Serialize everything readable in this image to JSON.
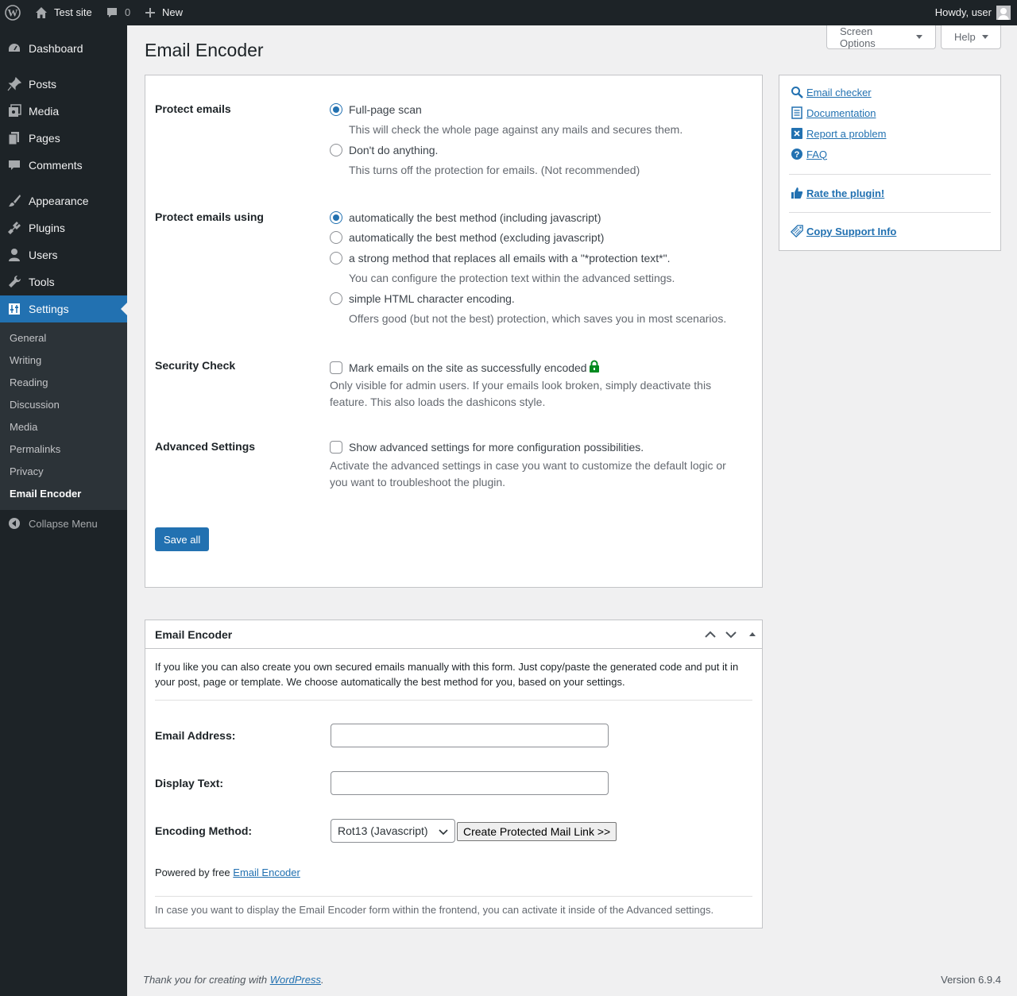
{
  "admin_bar": {
    "site_name": "Test site",
    "comments_count": "0",
    "new_label": "New",
    "howdy": "Howdy, user"
  },
  "sidebar": {
    "items": [
      {
        "label": "Dashboard",
        "icon": "dashboard-icon"
      },
      {
        "label": "Posts",
        "icon": "pin-icon"
      },
      {
        "label": "Media",
        "icon": "media-icon"
      },
      {
        "label": "Pages",
        "icon": "pages-icon"
      },
      {
        "label": "Comments",
        "icon": "comment-icon"
      },
      {
        "label": "Appearance",
        "icon": "brush-icon"
      },
      {
        "label": "Plugins",
        "icon": "plug-icon"
      },
      {
        "label": "Users",
        "icon": "user-icon"
      },
      {
        "label": "Tools",
        "icon": "wrench-icon"
      },
      {
        "label": "Settings",
        "icon": "sliders-icon"
      }
    ],
    "submenu": [
      "General",
      "Writing",
      "Reading",
      "Discussion",
      "Media",
      "Permalinks",
      "Privacy",
      "Email Encoder"
    ],
    "collapse_label": "Collapse Menu"
  },
  "screen_meta": {
    "screen_options": "Screen Options",
    "help": "Help"
  },
  "page_title": "Email Encoder",
  "settings": {
    "protect_emails": {
      "label": "Protect emails",
      "options": [
        {
          "label": "Full-page scan",
          "desc": "This will check the whole page against any mails and secures them.",
          "checked": true
        },
        {
          "label": "Don't do anything.",
          "desc": "This turns off the protection for emails. (Not recommended)",
          "checked": false
        }
      ]
    },
    "protect_using": {
      "label": "Protect emails using",
      "options": [
        {
          "label": "automatically the best method (including javascript)",
          "desc": "",
          "checked": true
        },
        {
          "label": "automatically the best method (excluding javascript)",
          "desc": "",
          "checked": false
        },
        {
          "label": "a strong method that replaces all emails with a \"*protection text*\".",
          "desc": "You can configure the protection text within the advanced settings.",
          "checked": false
        },
        {
          "label": "simple HTML character encoding.",
          "desc": "Offers good (but not the best) protection, which saves you in most scenarios.",
          "checked": false
        }
      ]
    },
    "security_check": {
      "label": "Security Check",
      "checkbox_label": "Mark emails on the site as successfully encoded",
      "desc": "Only visible for admin users. If your emails look broken, simply deactivate this feature. This also loads the dashicons style.",
      "checked": false
    },
    "advanced": {
      "label": "Advanced Settings",
      "checkbox_label": "Show advanced settings for more configuration possibilities.",
      "desc": "Activate the advanced settings in case you want to customize the default logic or you want to troubleshoot the plugin.",
      "checked": false
    },
    "save_label": "Save all"
  },
  "side_links": {
    "email_checker": "Email checker",
    "documentation": "Documentation",
    "report_problem": "Report a problem",
    "faq": "FAQ",
    "rate": "Rate the plugin!",
    "copy_support": "Copy Support Info"
  },
  "encoder_panel": {
    "title": "Email Encoder",
    "intro": "If you like you can also create you own secured emails manually with this form. Just copy/paste the generated code and put it in your post, page or template. We choose automatically the best method for you, based on your settings.",
    "email_label": "Email Address:",
    "email_value": "",
    "display_label": "Display Text:",
    "display_value": "",
    "method_label": "Encoding Method:",
    "method_value": "Rot13 (Javascript)",
    "create_button": "Create Protected Mail Link >>",
    "powered_prefix": "Powered by free",
    "powered_link": "Email Encoder",
    "frontend_note": "In case you want to display the Email Encoder form within the frontend, you can activate it inside of the Advanced settings."
  },
  "footer": {
    "thanks_prefix": "Thank you for creating with",
    "thanks_link": "WordPress",
    "thanks_suffix": ".",
    "version": "Version 6.9.4"
  },
  "colors": {
    "accent": "#2271b1",
    "admin_bar": "#1d2327",
    "lock_green": "#008a20"
  }
}
